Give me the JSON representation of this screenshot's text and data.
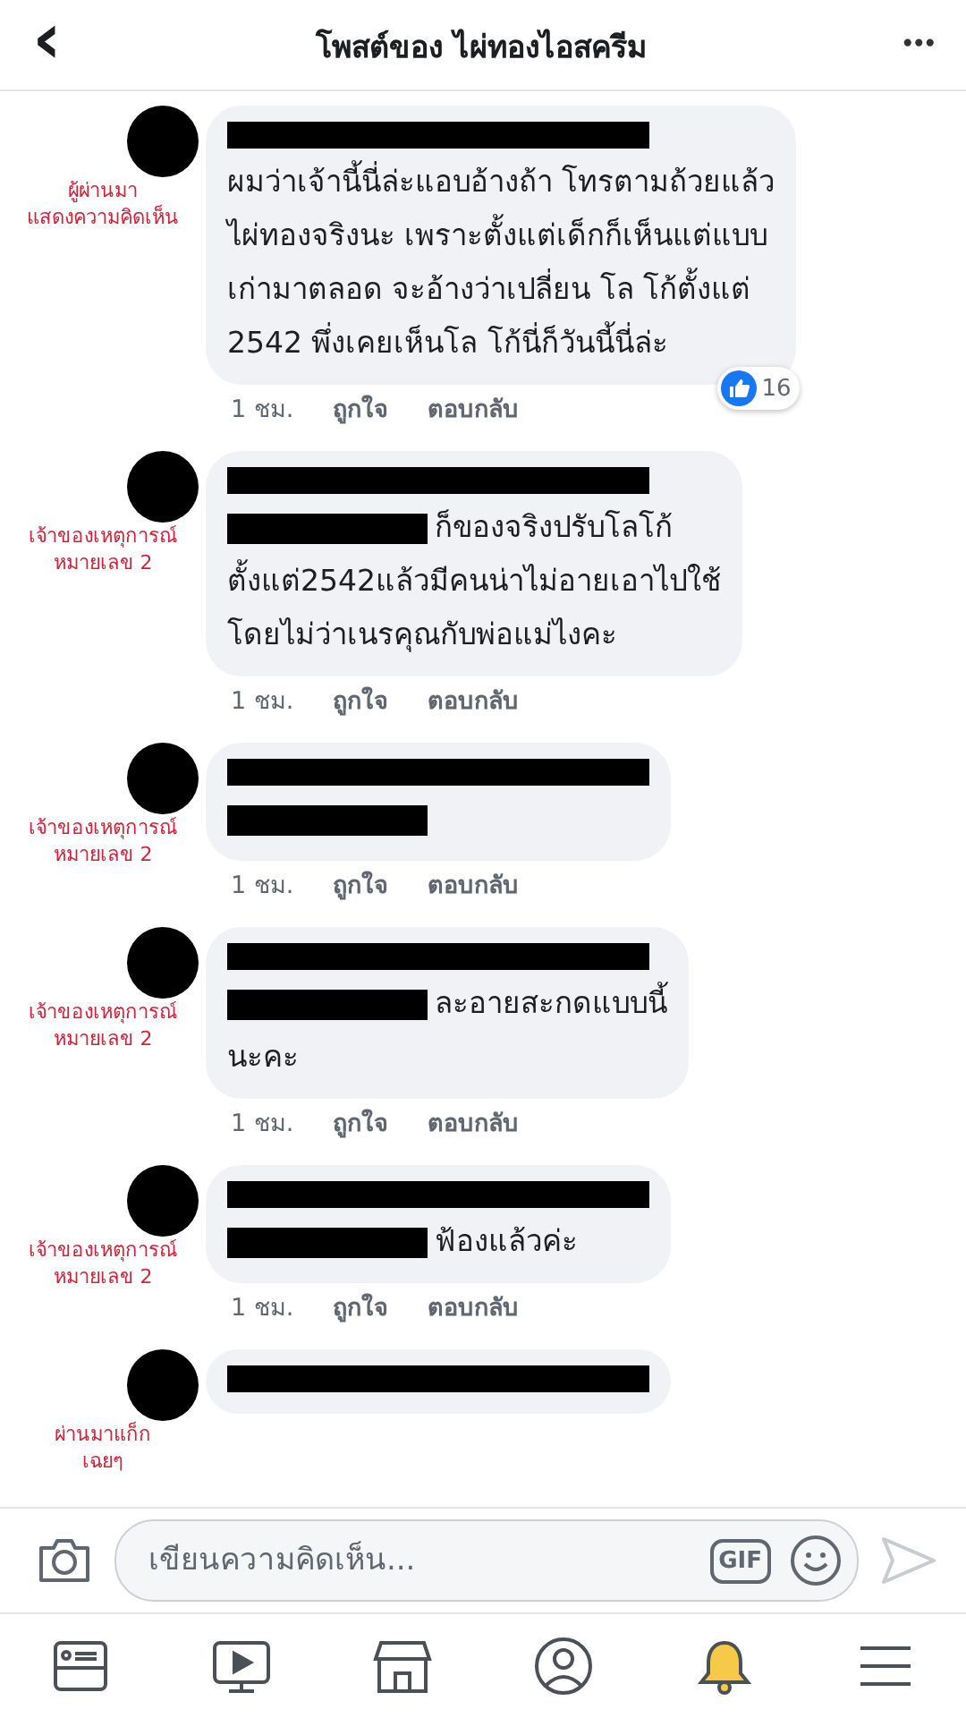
{
  "header": {
    "back": "‹",
    "title": "โพสต์ของ ไผ่ทองไอสครีม",
    "more": "•••"
  },
  "comments": [
    {
      "annotation": [
        "ผู้ผ่านมา",
        "แสดงความคิดเห็น"
      ],
      "lines": [
        {
          "redacted": false,
          "text": "ผมว่าเจ้านี้นี่ล่ะแอบอ้างถ้า โทรตามถ้วยแล้ว"
        },
        {
          "redacted": false,
          "text": "ไผ่ทองจริงนะ เพราะตั้งแต่เด็กก็เห็นแต่แบบ"
        },
        {
          "redacted": false,
          "text": "เก่ามาตลอด จะอ้างว่าเปลี่ยน โล โก้ตั้งแต่"
        },
        {
          "redacted": false,
          "text": "2542 พึ่งเคยเห็นโล โก้นี่ก็วันนี้นี่ล่ะ"
        }
      ],
      "time": "1 ชม.",
      "like": "ถูกใจ",
      "reply": "ตอบกลับ",
      "reactions": "16"
    },
    {
      "annotation": [
        "เจ้าของเหตุการณ์",
        "หมายเลข 2"
      ],
      "lines": [
        {
          "redacted": true,
          "text": "ก็ของจริงปรับโลโก้"
        },
        {
          "redacted": false,
          "text": "ตั้งแต่2542แล้วมีคนน่าไม่อายเอาไปใช้"
        },
        {
          "redacted": false,
          "text": "โดยไม่ว่าเนรคุณกับพ่อแม่ไงคะ"
        }
      ],
      "time": "1 ชม.",
      "like": "ถูกใจ",
      "reply": "ตอบกลับ"
    },
    {
      "annotation": [
        "เจ้าของเหตุการณ์",
        "หมายเลข 2"
      ],
      "lines": [
        {
          "redacted": true
        }
      ],
      "time": "1 ชม.",
      "like": "ถูกใจ",
      "reply": "ตอบกลับ"
    },
    {
      "annotation": [
        "เจ้าของเหตุการณ์",
        "หมายเลข 2"
      ],
      "lines": [
        {
          "redacted": true,
          "text": "ละอายสะกดแบบนี้"
        },
        {
          "redacted": false,
          "text": "นะคะ"
        }
      ],
      "time": "1 ชม.",
      "like": "ถูกใจ",
      "reply": "ตอบกลับ"
    },
    {
      "annotation": [
        "เจ้าของเหตุการณ์",
        "หมายเลข 2"
      ],
      "lines": [
        {
          "redacted": true,
          "text": "ฟ้องแล้วค่ะ"
        }
      ],
      "time": "1 ชม.",
      "like": "ถูกใจ",
      "reply": "ตอบกลับ"
    },
    {
      "annotation": [
        "ผ่านมาแก็ก",
        "เฉยๆ"
      ]
    }
  ],
  "composer": {
    "placeholder": "เขียนความคิดเห็น...",
    "gif": "GIF"
  },
  "nav": [
    {
      "kind": "feed",
      "selected": false
    },
    {
      "kind": "video",
      "selected": false
    },
    {
      "kind": "market",
      "selected": false
    },
    {
      "kind": "profile",
      "selected": false
    },
    {
      "kind": "bell",
      "selected": true
    },
    {
      "kind": "menu",
      "selected": false
    }
  ]
}
